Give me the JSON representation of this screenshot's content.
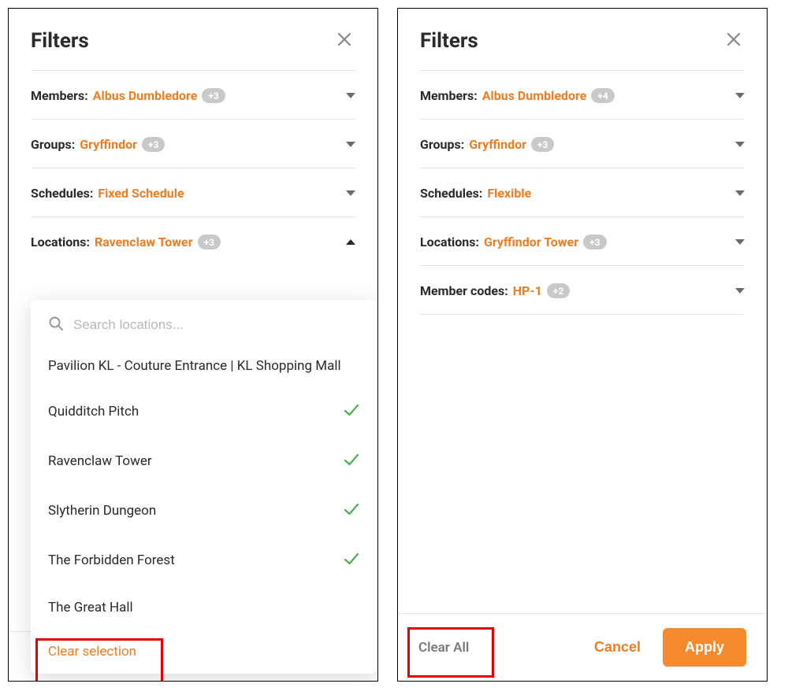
{
  "left": {
    "title": "Filters",
    "filters": {
      "members": {
        "label": "Members",
        "value": "Albus Dumbledore",
        "extra": "+3"
      },
      "groups": {
        "label": "Groups",
        "value": "Gryffindor",
        "extra": "+3"
      },
      "schedules": {
        "label": "Schedules",
        "value": "Fixed Schedule"
      },
      "locations": {
        "label": "Locations",
        "value": "Ravenclaw Tower",
        "extra": "+3"
      }
    },
    "search_placeholder": "Search locations...",
    "options": [
      {
        "label": "Pavilion KL - Couture Entrance | KL Shopping Mall",
        "selected": false
      },
      {
        "label": "Quidditch Pitch",
        "selected": true
      },
      {
        "label": "Ravenclaw Tower",
        "selected": true
      },
      {
        "label": "Slytherin Dungeon",
        "selected": true
      },
      {
        "label": "The Forbidden Forest",
        "selected": true
      },
      {
        "label": "The Great Hall",
        "selected": false
      }
    ],
    "clear_selection": "Clear selection"
  },
  "right": {
    "title": "Filters",
    "filters": {
      "members": {
        "label": "Members",
        "value": "Albus Dumbledore",
        "extra": "+4"
      },
      "groups": {
        "label": "Groups",
        "value": "Gryffindor",
        "extra": "+3"
      },
      "schedules": {
        "label": "Schedules",
        "value": "Flexible"
      },
      "locations": {
        "label": "Locations",
        "value": "Gryffindor Tower",
        "extra": "+3"
      },
      "member_codes": {
        "label": "Member codes",
        "value": "HP-1",
        "extra": "+2"
      }
    },
    "footer": {
      "clear_all": "Clear All",
      "cancel": "Cancel",
      "apply": "Apply"
    }
  }
}
